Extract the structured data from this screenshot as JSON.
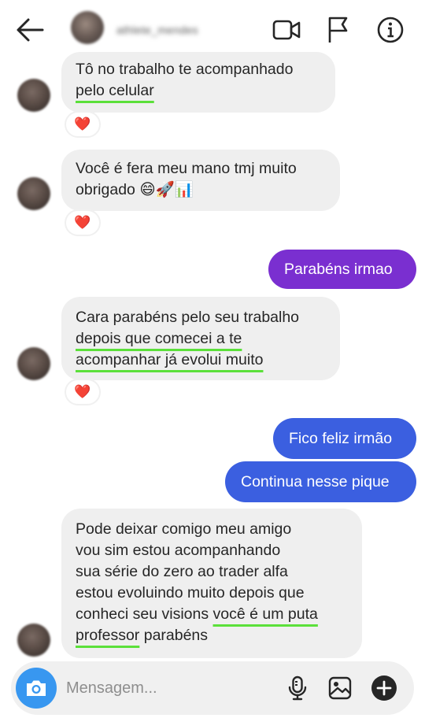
{
  "header": {
    "username": "athlete_mendes",
    "back_icon": "arrow-left-icon",
    "video_icon": "video-camera-icon",
    "flag_icon": "flag-icon",
    "info_icon": "info-icon"
  },
  "messages": [
    {
      "lines": [
        "Tô no trabalho te acompanhado",
        "pelo celular"
      ],
      "reaction": "❤️"
    },
    {
      "lines": [
        "Você é fera meu mano tmj muito",
        "obrigado 😄🚀📊"
      ],
      "reaction": "❤️"
    },
    {
      "text": "Parabéns irmao"
    },
    {
      "lines": [
        "Cara parabéns pelo seu trabalho",
        "depois que comecei a te",
        "acompanhar já evolui muito"
      ],
      "reaction": "❤️"
    },
    {
      "text": "Fico feliz irmão"
    },
    {
      "text": "Continua nesse pique"
    },
    {
      "lines": [
        "Pode deixar comigo meu amigo",
        "vou sim estou acompanhando",
        "sua série do zero ao trader alfa",
        "estou evoluindo muito depois que",
        "conheci seu visions",
        "você é um puta",
        "professor",
        "parabéns"
      ]
    }
  ],
  "composer": {
    "placeholder": "Mensagem...",
    "camera_icon": "camera-icon",
    "mic_icon": "microphone-icon",
    "gallery_icon": "image-icon",
    "plus_icon": "plus-circle-icon"
  },
  "colors": {
    "outgoing_purple": "#7a2fd0",
    "outgoing_blue": "#3b5fe0",
    "incoming_bg": "#efefef",
    "underline_green": "#5be03a",
    "camera_blue": "#3897f0"
  }
}
